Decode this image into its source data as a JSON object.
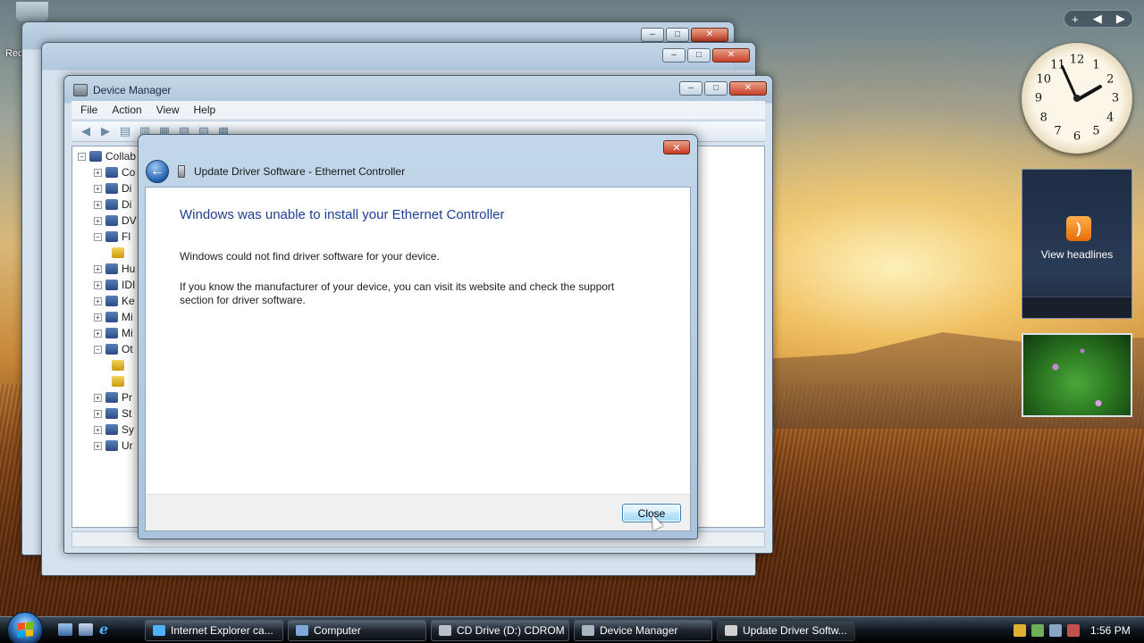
{
  "desktop": {
    "recycle_label": "Rec"
  },
  "devmgr": {
    "title": "Device Manager",
    "menu": [
      "File",
      "Action",
      "View",
      "Help"
    ],
    "tree": [
      {
        "label": "Collab",
        "exp": "−"
      },
      {
        "label": "Co",
        "exp": "+"
      },
      {
        "label": "Di",
        "exp": "+"
      },
      {
        "label": "Di",
        "exp": "+"
      },
      {
        "label": "DV",
        "exp": "+"
      },
      {
        "label": "Fl",
        "exp": "−"
      },
      {
        "label": "",
        "exp": ""
      },
      {
        "label": "Hu",
        "exp": "+"
      },
      {
        "label": "IDI",
        "exp": "+"
      },
      {
        "label": "Ke",
        "exp": "+"
      },
      {
        "label": "Mi",
        "exp": "+"
      },
      {
        "label": "Mi",
        "exp": "+"
      },
      {
        "label": "Ot",
        "exp": "−"
      },
      {
        "label": "",
        "exp": ""
      },
      {
        "label": "",
        "exp": ""
      },
      {
        "label": "Pr",
        "exp": "+"
      },
      {
        "label": "St",
        "exp": "+"
      },
      {
        "label": "Sy",
        "exp": "+"
      },
      {
        "label": "Ur",
        "exp": "+"
      }
    ]
  },
  "dialog": {
    "title": "Update Driver Software - Ethernet Controller",
    "heading": "Windows was unable to install your Ethernet Controller",
    "message1": "Windows could not find driver software for your device.",
    "message2": "If you know the manufacturer of your device, you can visit its website and check the support section for driver software.",
    "close_label": "Close",
    "close_glyph": "✕"
  },
  "gadgets": {
    "sidebar_controls": [
      "+",
      "◀",
      "▶"
    ],
    "clock": {
      "numbers": [
        "12",
        "1",
        "2",
        "3",
        "4",
        "5",
        "6",
        "7",
        "8",
        "9",
        "10",
        "11"
      ]
    },
    "feed_label": "View headlines"
  },
  "taskbar": {
    "buttons": [
      {
        "label": "Internet Explorer ca...",
        "icon": "ie-icon",
        "color": "#4fb0ff"
      },
      {
        "label": "Computer",
        "icon": "computer-icon",
        "color": "#7fa8d8"
      },
      {
        "label": "CD Drive (D:) CDROM",
        "icon": "cd-drive-icon",
        "color": "#b8c0c8"
      },
      {
        "label": "Device Manager",
        "icon": "device-manager-icon",
        "color": "#a8b4bf"
      },
      {
        "label": "Update Driver Softw...",
        "icon": "driver-icon",
        "color": "#d0d0d0",
        "active": true
      }
    ],
    "time": "1:56 PM"
  }
}
